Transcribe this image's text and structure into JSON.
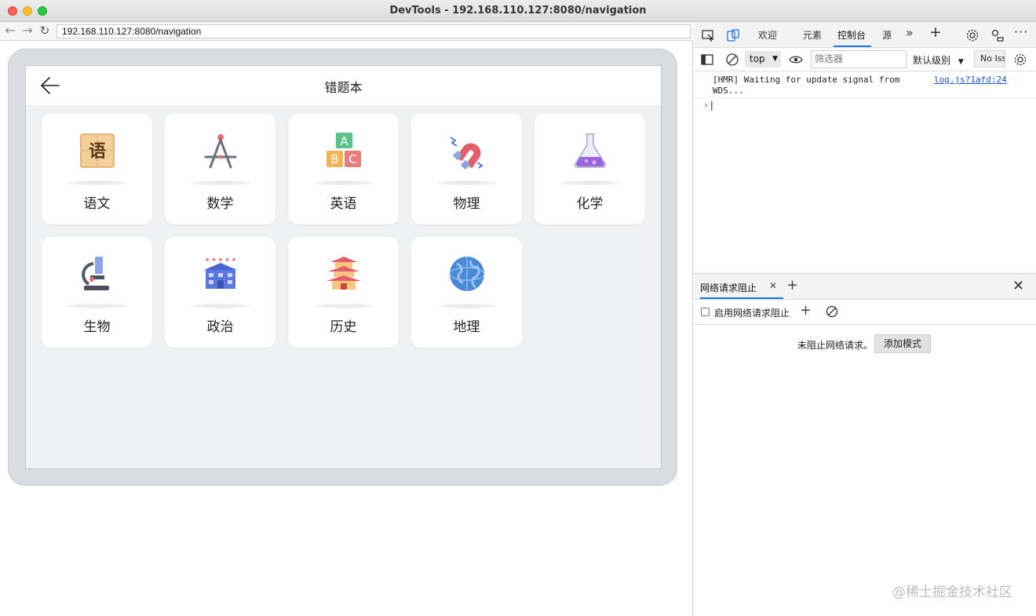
{
  "window": {
    "title": "DevTools - 192.168.110.127:8080/navigation"
  },
  "browser": {
    "url": "192.168.110.127:8080/navigation"
  },
  "app": {
    "title": "错题本",
    "subjects": [
      {
        "label": "语文",
        "icon": "chinese-book-icon"
      },
      {
        "label": "数学",
        "icon": "compass-icon"
      },
      {
        "label": "英语",
        "icon": "abc-blocks-icon"
      },
      {
        "label": "物理",
        "icon": "magnet-icon"
      },
      {
        "label": "化学",
        "icon": "flask-icon"
      },
      {
        "label": "生物",
        "icon": "microscope-icon"
      },
      {
        "label": "政治",
        "icon": "government-building-icon"
      },
      {
        "label": "历史",
        "icon": "pagoda-icon"
      },
      {
        "label": "地理",
        "icon": "globe-icon"
      }
    ]
  },
  "devtools": {
    "tabs": [
      "欢迎",
      "元素",
      "控制台",
      "源"
    ],
    "active_tab": "控制台",
    "context": "top",
    "filter_placeholder": "筛选器",
    "level": "默认级别",
    "issues": "No Issues",
    "console": {
      "message": "[HMR] Waiting for update signal from WDS...",
      "source": "log.js?1afd:24",
      "prompt": "›"
    },
    "drawer": {
      "tab": "网络请求阻止",
      "enable_label": "启用网络请求阻止",
      "empty_text": "未阻止网络请求。",
      "add_pattern": "添加模式"
    }
  },
  "watermark": "@稀土掘金技术社区",
  "colors": {
    "accent": "#1a73e8",
    "device_frame": "#d9dce1",
    "screen_bg": "#f0f1f3"
  }
}
